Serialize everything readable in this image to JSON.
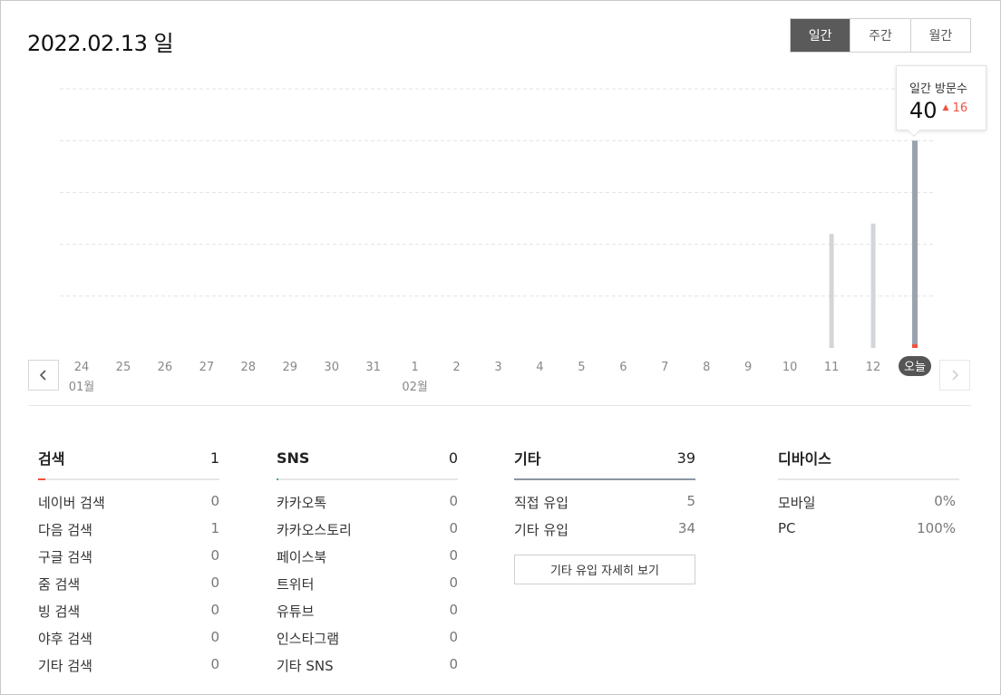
{
  "header": {
    "date_title": "2022.02.13 일",
    "period_tabs": [
      "일간",
      "주간",
      "월간"
    ],
    "active_tab": "일간"
  },
  "tooltip": {
    "label": "일간 방문수",
    "value": "40",
    "delta_arrow": "▲",
    "delta": "16"
  },
  "chart_data": {
    "type": "bar",
    "categories": [
      "24",
      "25",
      "26",
      "27",
      "28",
      "29",
      "30",
      "31",
      "1",
      "2",
      "3",
      "4",
      "5",
      "6",
      "7",
      "8",
      "9",
      "10",
      "11",
      "12",
      "오늘"
    ],
    "month_labels": [
      {
        "index": 0,
        "label": "01월"
      },
      {
        "index": 8,
        "label": "02월"
      }
    ],
    "values": [
      0,
      0,
      0,
      0,
      0,
      0,
      0,
      0,
      0,
      0,
      0,
      0,
      0,
      0,
      0,
      0,
      0,
      0,
      22,
      24,
      40
    ],
    "ylim": [
      0,
      50
    ],
    "grid": true,
    "highlight_index": 20,
    "colors": {
      "bar": "#d2d5d9",
      "bar_active": "#9aa3ad",
      "today_marker": "#f0523e",
      "grid": "#e3e3e3",
      "today_badge": "#555555"
    }
  },
  "panels": {
    "search": {
      "title": "검색",
      "total": "1",
      "accent": "#f0523e",
      "items": [
        {
          "label": "네이버 검색",
          "value": "0"
        },
        {
          "label": "다음 검색",
          "value": "1"
        },
        {
          "label": "구글 검색",
          "value": "0"
        },
        {
          "label": "줌 검색",
          "value": "0"
        },
        {
          "label": "빙 검색",
          "value": "0"
        },
        {
          "label": "야후 검색",
          "value": "0"
        },
        {
          "label": "기타 검색",
          "value": "0"
        }
      ]
    },
    "sns": {
      "title": "SNS",
      "total": "0",
      "accent": "#3bb38a",
      "items": [
        {
          "label": "카카오톡",
          "value": "0"
        },
        {
          "label": "카카오스토리",
          "value": "0"
        },
        {
          "label": "페이스북",
          "value": "0"
        },
        {
          "label": "트위터",
          "value": "0"
        },
        {
          "label": "유튜브",
          "value": "0"
        },
        {
          "label": "인스타그램",
          "value": "0"
        },
        {
          "label": "기타 SNS",
          "value": "0"
        }
      ]
    },
    "etc": {
      "title": "기타",
      "total": "39",
      "accent": "#8b96a2",
      "items": [
        {
          "label": "직접 유입",
          "value": "5"
        },
        {
          "label": "기타 유입",
          "value": "34"
        }
      ],
      "detail_button": "기타 유입 자세히 보기"
    },
    "device": {
      "title": "디바이스",
      "items": [
        {
          "label": "모바일",
          "value": "0%"
        },
        {
          "label": "PC",
          "value": "100%"
        }
      ]
    }
  }
}
